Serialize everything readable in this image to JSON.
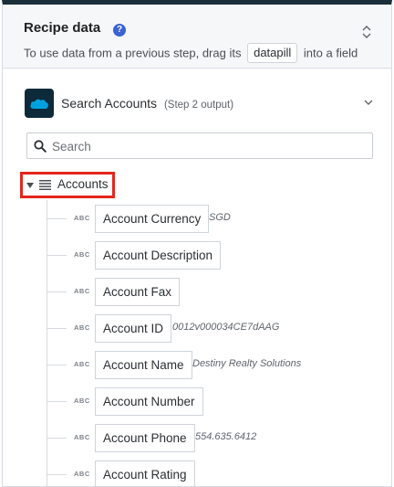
{
  "header": {
    "title": "Recipe data",
    "help_icon": "?",
    "subtitle_before": "To use data from a previous step, drag its",
    "subtitle_pill": "datapill",
    "subtitle_after": "into a field"
  },
  "source": {
    "logo_text": "salesforce",
    "name": "Search Accounts",
    "meta": "(Step 2 output)"
  },
  "search": {
    "placeholder": "Search",
    "value": ""
  },
  "group": {
    "label": "Accounts"
  },
  "fields": [
    {
      "type": "ABC",
      "label": "Account Currency",
      "sample": "SGD"
    },
    {
      "type": "ABC",
      "label": "Account Description",
      "sample": ""
    },
    {
      "type": "ABC",
      "label": "Account Fax",
      "sample": ""
    },
    {
      "type": "ABC",
      "label": "Account ID",
      "sample": "0012v000034CE7dAAG"
    },
    {
      "type": "ABC",
      "label": "Account Name",
      "sample": "Destiny Realty Solutions"
    },
    {
      "type": "ABC",
      "label": "Account Number",
      "sample": ""
    },
    {
      "type": "ABC",
      "label": "Account Phone",
      "sample": "554.635.6412"
    },
    {
      "type": "ABC",
      "label": "Account Rating",
      "sample": ""
    }
  ],
  "colors": {
    "accent": "#3b63d6",
    "highlight": "#e4261d",
    "top_bar": "#1b2f3a",
    "logo_bg": "#0c2a3a",
    "salesforce_blue": "#00a1e0"
  }
}
